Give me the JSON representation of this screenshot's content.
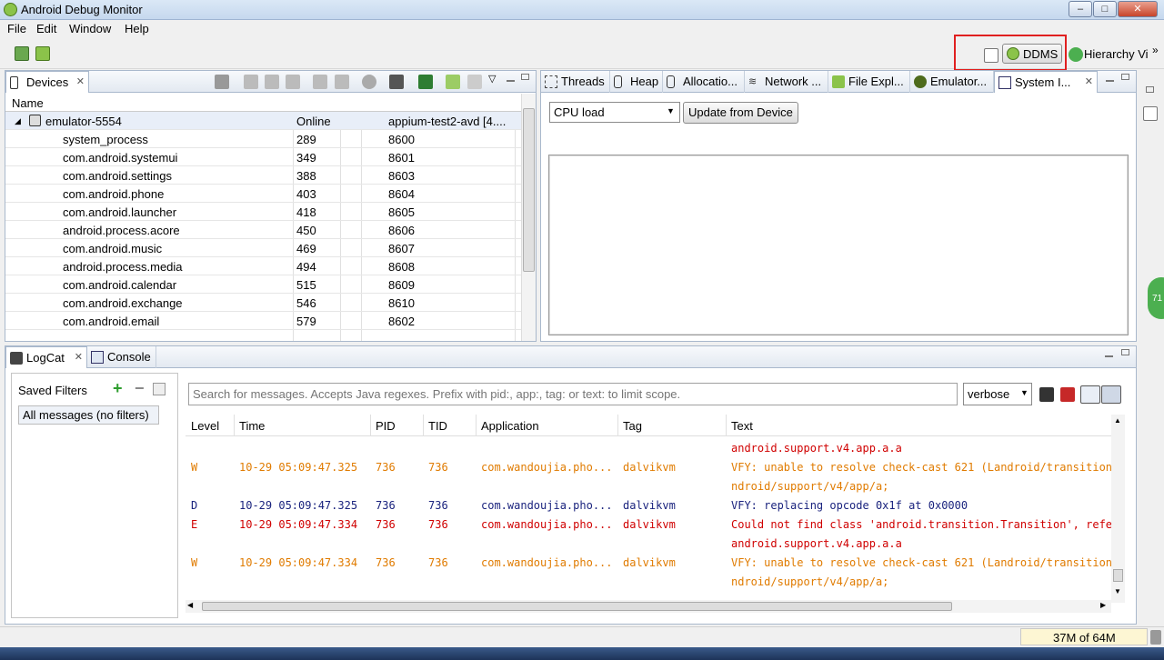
{
  "window": {
    "title": "Android Debug Monitor",
    "min": "–",
    "max": "□",
    "close": "✕"
  },
  "menu": [
    "File",
    "Edit",
    "Window",
    "Help"
  ],
  "perspectives": {
    "ddms": "DDMS",
    "hierarchy": "Hierarchy Vi",
    "more": "»"
  },
  "devices_panel": {
    "tab_label": "Devices",
    "header_name": "Name",
    "device": {
      "name": "emulator-5554",
      "status": "Online",
      "avd": "appium-test2-avd [4...."
    },
    "processes": [
      {
        "name": "system_process",
        "pid": "289",
        "port": "8600"
      },
      {
        "name": "com.android.systemui",
        "pid": "349",
        "port": "8601"
      },
      {
        "name": "com.android.settings",
        "pid": "388",
        "port": "8603"
      },
      {
        "name": "com.android.phone",
        "pid": "403",
        "port": "8604"
      },
      {
        "name": "com.android.launcher",
        "pid": "418",
        "port": "8605"
      },
      {
        "name": "android.process.acore",
        "pid": "450",
        "port": "8606"
      },
      {
        "name": "com.android.music",
        "pid": "469",
        "port": "8607"
      },
      {
        "name": "android.process.media",
        "pid": "494",
        "port": "8608"
      },
      {
        "name": "com.android.calendar",
        "pid": "515",
        "port": "8609"
      },
      {
        "name": "com.android.exchange",
        "pid": "546",
        "port": "8610"
      },
      {
        "name": "com.android.email",
        "pid": "579",
        "port": "8602"
      }
    ]
  },
  "right_tabs": [
    "Threads",
    "Heap",
    "Allocatio...",
    "Network ...",
    "File Expl...",
    "Emulator...",
    "System I..."
  ],
  "sysinfo": {
    "select_value": "CPU load",
    "update_button": "Update from Device"
  },
  "bottom_tabs": {
    "logcat": "LogCat",
    "console": "Console"
  },
  "filters": {
    "title": "Saved Filters",
    "items": [
      "All messages (no filters)"
    ]
  },
  "logcat": {
    "search_placeholder": "Search for messages. Accepts Java regexes. Prefix with pid:, app:, tag: or text: to limit scope.",
    "level_select": "verbose",
    "columns": [
      "Level",
      "Time",
      "PID",
      "TID",
      "Application",
      "Tag",
      "Text"
    ],
    "colors": {
      "W": "#e07b00",
      "D": "#1a237e",
      "E": "#d00000"
    },
    "rows": [
      {
        "level": "",
        "time": "",
        "pid": "",
        "tid": "",
        "app": "",
        "tag": "",
        "text": "android.support.v4.app.a.a",
        "color": "#d00000"
      },
      {
        "level": "W",
        "time": "10-29 05:09:47.325",
        "pid": "736",
        "tid": "736",
        "app": "com.wandoujia.pho...",
        "tag": "dalvikvm",
        "text": "VFY: unable to resolve check-cast 621 (Landroid/transition/T",
        "color": "#e07b00"
      },
      {
        "level": "",
        "time": "",
        "pid": "",
        "tid": "",
        "app": "",
        "tag": "",
        "text": "ndroid/support/v4/app/a;",
        "color": "#e07b00"
      },
      {
        "level": "D",
        "time": "10-29 05:09:47.325",
        "pid": "736",
        "tid": "736",
        "app": "com.wandoujia.pho...",
        "tag": "dalvikvm",
        "text": "VFY: replacing opcode 0x1f at 0x0000",
        "color": "#1a237e"
      },
      {
        "level": "E",
        "time": "10-29 05:09:47.334",
        "pid": "736",
        "tid": "736",
        "app": "com.wandoujia.pho...",
        "tag": "dalvikvm",
        "text": "Could not find class 'android.transition.Transition', refere",
        "color": "#d00000"
      },
      {
        "level": "",
        "time": "",
        "pid": "",
        "tid": "",
        "app": "",
        "tag": "",
        "text": "android.support.v4.app.a.a",
        "color": "#d00000"
      },
      {
        "level": "W",
        "time": "10-29 05:09:47.334",
        "pid": "736",
        "tid": "736",
        "app": "com.wandoujia.pho...",
        "tag": "dalvikvm",
        "text": "VFY: unable to resolve check-cast 621 (Landroid/transition/T",
        "color": "#e07b00"
      },
      {
        "level": "",
        "time": "",
        "pid": "",
        "tid": "",
        "app": "",
        "tag": "",
        "text": "ndroid/support/v4/app/a;",
        "color": "#e07b00"
      }
    ]
  },
  "status": {
    "heap": "37M of 64M"
  },
  "badge": {
    "text": "71"
  }
}
